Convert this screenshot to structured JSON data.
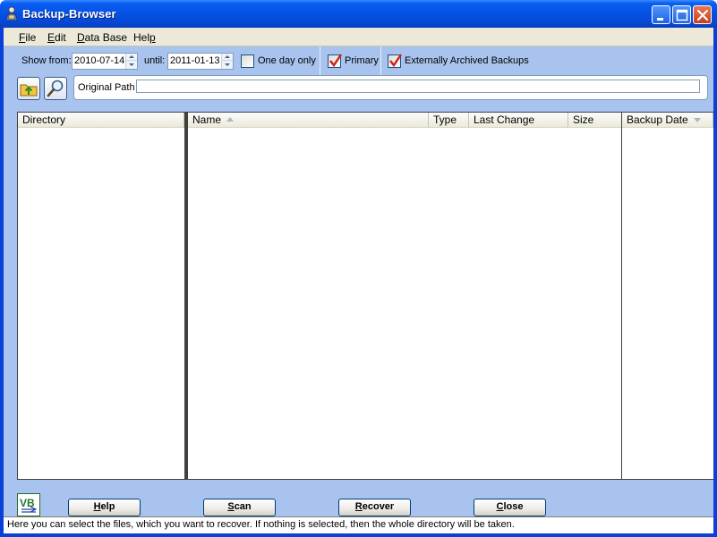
{
  "window": {
    "title": "Backup-Browser"
  },
  "menu": {
    "items": [
      {
        "label": "File",
        "mnemonic": "F",
        "rest": "ile"
      },
      {
        "label": "Edit",
        "mnemonic": "E",
        "rest": "dit"
      },
      {
        "label": "Data Base",
        "mnemonic": "D",
        "rest": "ata Base"
      },
      {
        "label": "Help",
        "pre": "Hel",
        "mnemonic": "p"
      }
    ]
  },
  "filters": {
    "show_from_label": "Show from:",
    "from_date": "2010-07-14",
    "until_label": "until:",
    "until_date": "2011-01-13",
    "one_day_only_label": "One day only",
    "one_day_only_checked": false,
    "primary_label": "Primary",
    "primary_checked": true,
    "external_label": "Externally Archived Backups",
    "external_checked": true
  },
  "path": {
    "label": "Original Path",
    "value": ""
  },
  "tree": {
    "header": "Directory"
  },
  "files": {
    "columns": [
      "Name",
      "Type",
      "Last Change",
      "Size"
    ],
    "rows": []
  },
  "versions": {
    "header": "Backup Date"
  },
  "buttons": {
    "help": {
      "mnemonic": "H",
      "rest": "elp"
    },
    "scan": {
      "mnemonic": "S",
      "rest": "can"
    },
    "recover": {
      "mnemonic": "R",
      "rest": "ecover"
    },
    "close": {
      "mnemonic": "C",
      "rest": "lose"
    }
  },
  "logo_text": "VB",
  "status": "Here you can select the files, which you want to recover. If nothing is selected, then the whole directory will be taken.",
  "colors": {
    "titlebar": "#0553e4",
    "content": "#a8c4ee",
    "checkmark": "#c8201e"
  }
}
